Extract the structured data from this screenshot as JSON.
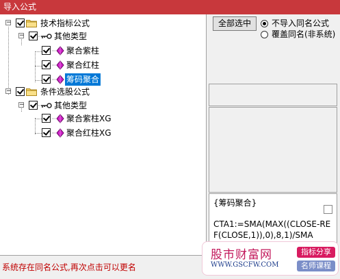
{
  "window": {
    "title": "导入公式"
  },
  "tree": {
    "root1": {
      "label": "技术指标公式",
      "group": {
        "label": "其他类型",
        "items": [
          {
            "label": "聚合紫柱"
          },
          {
            "label": "聚合红柱"
          },
          {
            "label": "筹码聚合"
          }
        ]
      }
    },
    "root2": {
      "label": "条件选股公式",
      "group": {
        "label": "其他类型",
        "items": [
          {
            "label": "聚合紫柱XG"
          },
          {
            "label": "聚合红柱XG"
          }
        ]
      }
    }
  },
  "options": {
    "select_all_label": "全部选中",
    "radio_skip_label": "不导入同名公式",
    "radio_overwrite_label": "覆盖同名(非系统)"
  },
  "preview": {
    "name": "{筹码聚合}",
    "code": "CTA1:=SMA(MAX((CLOSE-REF(CLOSE,1)),0),8,1)/SMA"
  },
  "status": {
    "message": "系统存在同名公式,再次点击可以更名"
  },
  "watermark": {
    "site_name": "股市财富网",
    "url": "WWW.GSCFW.COM",
    "tag1": "指标分享",
    "tag2": "名师课程"
  },
  "colors": {
    "titlebar": "#c8383c",
    "selection": "#0078d7",
    "status_text": "#c00000"
  }
}
